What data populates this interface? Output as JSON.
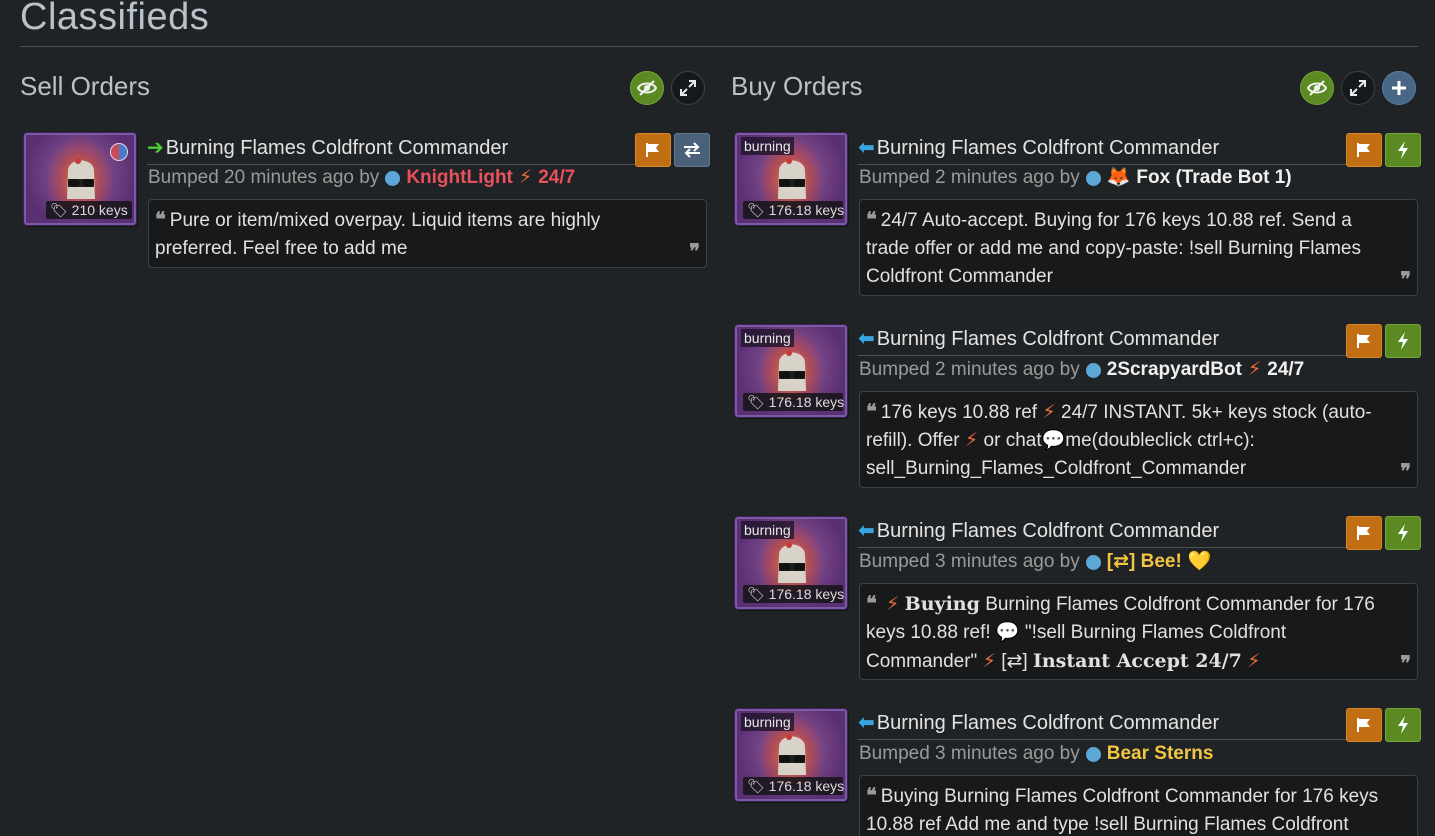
{
  "page": {
    "title": "Classifieds"
  },
  "colors": {
    "sell_arrow": "#4cd137",
    "buy_arrow": "#3aa3e3",
    "username_red": "#e8515d",
    "username_gold": "#f2c641",
    "username_white": "#f0f0f0",
    "bolt": "#ef6b3a"
  },
  "sell": {
    "heading": "Sell Orders",
    "listings": [
      {
        "item_name": "Burning Flames Coldfront Commander",
        "price": "210 keys",
        "bumped": "Bumped 20 minutes ago by",
        "username": "KnightLight",
        "tag": "24/7",
        "comment_line1": "Pure or item/mixed overpay. Liquid items are highly",
        "comment_line2": "preferred. Feel free to add me"
      }
    ]
  },
  "buy": {
    "heading": "Buy Orders",
    "listings": [
      {
        "item_name": "Burning Flames Coldfront Commander",
        "quality_label": "burning",
        "price": "176.18 keys",
        "bumped": "Bumped 2 minutes ago by",
        "username": "Fox (Trade Bot 1)",
        "comment_line1": "24/7 Auto-accept. Buying for 176 keys 10.88 ref. Send a",
        "comment_line2": "trade offer or add me and copy-paste: !sell Burning Flames",
        "comment_line3": "Coldfront Commander"
      },
      {
        "item_name": "Burning Flames Coldfront Commander",
        "quality_label": "burning",
        "price": "176.18 keys",
        "bumped": "Bumped 2 minutes ago by",
        "username": "2ScrapyardBot",
        "tag": "24/7",
        "comment_a": "176 keys 10.88 ref",
        "comment_b": "24/7 INSTANT. 5k+ keys stock (auto-",
        "comment_c": "refill). Offer",
        "comment_d": "or chat",
        "comment_e": "me(doubleclick ctrl+c):",
        "comment_f": "sell_Burning_Flames_Coldfront_Commander"
      },
      {
        "item_name": "Burning Flames Coldfront Commander",
        "quality_label": "burning",
        "price": "176.18 keys",
        "bumped": "Bumped 3 minutes ago by",
        "username": "[⇄] Bee!",
        "comment_bold1": "Buying",
        "comment_a": "Burning Flames Coldfront Commander for 176",
        "comment_b": "keys 10.88 ref!",
        "comment_c": "\"!sell Burning Flames Coldfront",
        "comment_d": "Commander\"",
        "comment_e": "[⇄]",
        "comment_bold2": "Instant Accept 24/7"
      },
      {
        "item_name": "Burning Flames Coldfront Commander",
        "quality_label": "burning",
        "price": "176.18 keys",
        "bumped": "Bumped 3 minutes ago by",
        "username": "Bear Sterns",
        "comment_line1": "Buying Burning Flames Coldfront Commander for 176 keys",
        "comment_line2": "10.88 ref Add me and type !sell Burning Flames Coldfront"
      }
    ]
  }
}
